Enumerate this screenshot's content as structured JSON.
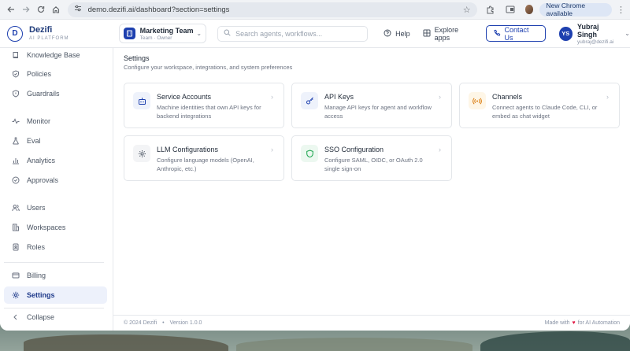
{
  "browser": {
    "url": "demo.dezifi.ai/dashboard?section=settings",
    "update_label": "New Chrome available"
  },
  "brand": {
    "name": "Dezifi",
    "tagline": "AI PLATFORM",
    "logo_letter": "D"
  },
  "team": {
    "name": "Marketing Team",
    "role": "Team · Owner"
  },
  "search": {
    "placeholder": "Search agents, workflows..."
  },
  "header": {
    "help_label": "Help",
    "explore_label": "Explore apps",
    "contact_label": "Contact Us"
  },
  "user": {
    "initials": "YS",
    "name": "Yubraj Singh",
    "email": "yubraj@dezifi.ai"
  },
  "sidebar": {
    "items": [
      {
        "label": "Knowledge Base",
        "icon": "book-icon"
      },
      {
        "label": "Policies",
        "icon": "shield-check-icon"
      },
      {
        "label": "Guardrails",
        "icon": "shield-icon"
      },
      {
        "label": "Monitor",
        "icon": "activity-icon"
      },
      {
        "label": "Eval",
        "icon": "flask-icon"
      },
      {
        "label": "Analytics",
        "icon": "bar-chart-icon"
      },
      {
        "label": "Approvals",
        "icon": "check-circle-icon"
      },
      {
        "label": "Users",
        "icon": "users-icon"
      },
      {
        "label": "Workspaces",
        "icon": "building-icon"
      },
      {
        "label": "Roles",
        "icon": "badge-icon"
      },
      {
        "label": "Billing",
        "icon": "card-icon"
      },
      {
        "label": "Settings",
        "icon": "gear-icon",
        "active": true
      }
    ],
    "collapse_label": "Collapse"
  },
  "settings": {
    "title": "Settings",
    "subtitle": "Configure your workspace, integrations, and system preferences",
    "cards": [
      {
        "title": "Service Accounts",
        "description": "Machine identities that own API keys for backend integrations",
        "icon": "robot-icon"
      },
      {
        "title": "API Keys",
        "description": "Manage API keys for agent and workflow access",
        "icon": "key-icon"
      },
      {
        "title": "Channels",
        "description": "Connect agents to Claude Code, CLI, or embed as chat widget",
        "icon": "broadcast-icon"
      },
      {
        "title": "LLM Configurations",
        "description": "Configure language models (OpenAI, Anthropic, etc.)",
        "icon": "gear-icon"
      },
      {
        "title": "SSO Configuration",
        "description": "Configure SAML, OIDC, or OAuth 2.0 single sign-on",
        "icon": "shield-icon"
      }
    ]
  },
  "footer": {
    "copyright": "© 2024 Dezifi",
    "version": "Version 1.0.0",
    "made_with_prefix": "Made with",
    "made_with_suffix": "for AI Automation"
  },
  "colors": {
    "brand": "#1e40af",
    "active_bg": "#edf1fb",
    "channels_icon": "#d97706",
    "sso_icon": "#16a34a"
  }
}
